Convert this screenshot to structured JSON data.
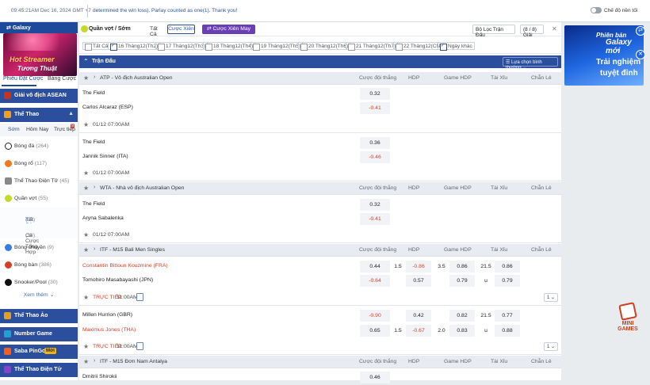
{
  "topbar": {
    "time": "09:45:21AM Dec 16, 2024 GMT +7",
    "ticker": "determined the win loss). Parlay counted as one(1). Thank you!",
    "toggle_label": "Chế độ nền tối"
  },
  "sidebar": {
    "galaxy_label": "Galaxy",
    "banner_line1": "Hot Streamer",
    "banner_line2": "Tương Thuật",
    "tab_betslip": "Phiếu Đặt Cược",
    "tab_table": "Bảng Cược",
    "sections": {
      "asean": "Giải vô địch ASEAN",
      "sports": "Thể Thao",
      "virtual": "Thể Thao Ảo",
      "number": "Number Game",
      "pingoal": "Saba PinGoal",
      "pingoal_badge": "Mới",
      "esports": "Thể Thao Điện Tử"
    },
    "subtabs": {
      "early": "Sớm",
      "today": "Hôm Nay",
      "live": "Trực tiếp",
      "live_count": "9"
    },
    "sports": [
      {
        "label": "Bóng đá",
        "count": "(264)"
      },
      {
        "label": "Bóng rổ",
        "count": "(117)"
      },
      {
        "label": "Thể Thao Điện Tử",
        "count": "(45)"
      },
      {
        "label": "Quần vợt",
        "count": "(55)"
      }
    ],
    "tennis_sub": [
      {
        "label": "Tất Cả",
        "count": "(55)"
      },
      {
        "label": "Cá Cược Tổng Hợp",
        "count": "(38)"
      }
    ],
    "sports2": [
      {
        "label": "Bóng chuyền",
        "count": "(9)"
      },
      {
        "label": "Bóng bàn",
        "count": "(386)"
      },
      {
        "label": "Snooker/Pool",
        "count": "(30)"
      }
    ],
    "more": "Xem thêm"
  },
  "filter": {
    "sport_label": "Quần vợt / Sớm",
    "select_all": "Tất Cả",
    "parlay_btn": "Cược Xiên",
    "lucky_btn": "Cược Xiên May Mắn",
    "league_filter": "Bộ Lọc Trận Đấu",
    "page_count": "(8 / 8) Giải"
  },
  "dates": [
    {
      "label": "Tất Cả",
      "checked": false
    },
    {
      "label": "16 Tháng12(Th2)",
      "checked": true
    },
    {
      "label": "17 Tháng12(Th3)",
      "checked": false
    },
    {
      "label": "18 Tháng12(Th4)",
      "checked": false
    },
    {
      "label": "19 Tháng12(Th5)",
      "checked": false
    },
    {
      "label": "20 Tháng12(Th6)",
      "checked": false
    },
    {
      "label": "21 Tháng12(Th7)",
      "checked": false
    },
    {
      "label": "22 Tháng12(CN)",
      "checked": false
    },
    {
      "label": "Ngày khác",
      "checked": true
    }
  ],
  "table": {
    "header_label": "Trận Đấu",
    "sort_label": "Lựa chọn bình thường",
    "cols": {
      "win": "Cược đội thắng",
      "hdp": "HDP",
      "game_hdp": "Game HDP",
      "ou": "Tài Xỉu",
      "odd_even": "Chẵn Lẻ"
    },
    "leagues": [
      {
        "name": "ATP - Vô địch Australian Open"
      },
      {
        "name": "WTA - Nhà vô địch Australian Open"
      },
      {
        "name": "ITF - M15 Bali Men Singles"
      },
      {
        "name": "ITF - M15 Đơn Nam Antalya"
      }
    ],
    "matches": {
      "m1": {
        "home": "The Field",
        "away": "Carlos Alcaraz (ESP)",
        "o1": "0.32",
        "o2": "-0.41",
        "time": "01/12 07:00AM"
      },
      "m2": {
        "home": "The Field",
        "away": "Jannik Sinner (ITA)",
        "o1": "0.36",
        "o2": "-0.46",
        "time": "01/12 07:00AM"
      },
      "m3": {
        "home": "The Field",
        "away": "Aryna Sabalenka",
        "o1": "0.32",
        "o2": "-0.41",
        "time": "01/12 07:00AM"
      },
      "m4": {
        "home": "Constantin Bittoun Kouzmine (FRA)",
        "away": "Tomohiro Masabayashi (JPN)",
        "w1": "0.44",
        "w2": "-0.64",
        "hdp": "1.5",
        "h1": "-0.86",
        "h2": "0.57",
        "ghdp": "3.5",
        "g1": "0.86",
        "g2": "0.79",
        "ou": "21.5",
        "ou_u": "u",
        "ou1": "0.86",
        "ou2": "0.79",
        "live": "TRỰC TIẾP",
        "live_time": "11:00AM",
        "dd": "1"
      },
      "m5": {
        "home": "Millen Hurrion (GBR)",
        "away": "Maximus Jones (THA)",
        "w1": "-0.90",
        "w2": "0.65",
        "hdp": "1.5",
        "h1": "0.42",
        "h2": "-0.67",
        "ghdp": "2.0",
        "g1": "0.82",
        "g2": "0.83",
        "ou": "21.5",
        "ou_u": "u",
        "ou1": "0.77",
        "ou2": "0.88",
        "live": "TRỰC TIẾP",
        "live_time": "11:00AM",
        "dd": "1"
      },
      "m6": {
        "home": "Dmitrii Shirokii",
        "o1": "0.46"
      }
    }
  },
  "right": {
    "banner_l1": "Phiên bản",
    "banner_l2": "Galaxy mới",
    "banner_l3": "Trải nghiệm",
    "banner_l4": "tuyệt đỉnh",
    "mini_l1": "MINI",
    "mini_l2": "GAMES"
  },
  "colors": {
    "primary": "#2b4f9c",
    "accent_red": "#d6402b",
    "purple": "#6a3fb5"
  }
}
